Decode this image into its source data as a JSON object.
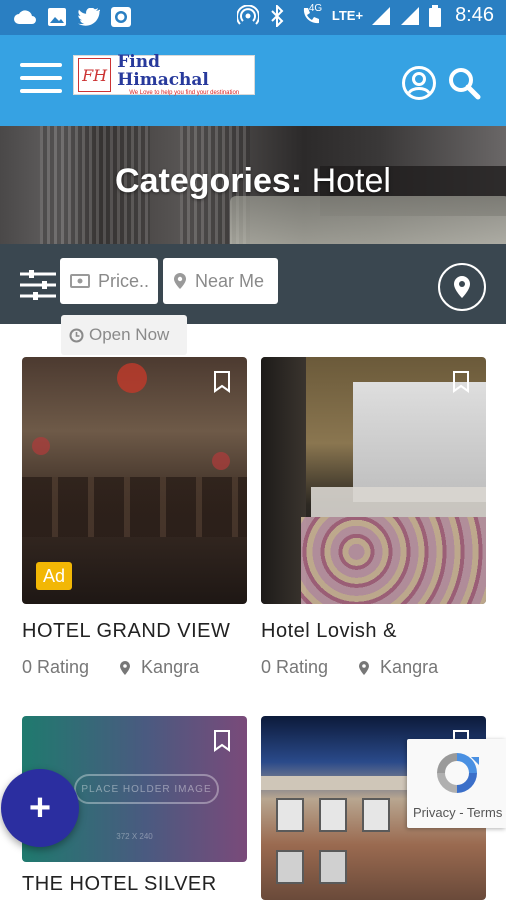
{
  "status_bar": {
    "time": "8:46",
    "network": "4G",
    "lte": "LTE+",
    "left_icons": [
      "cloud-icon",
      "image-icon",
      "twitter-icon",
      "camera-icon"
    ],
    "right_icons": [
      "hotspot-icon",
      "bluetooth-icon",
      "call-icon",
      "signal-icon",
      "signal-icon",
      "battery-icon"
    ]
  },
  "app_bar": {
    "logo_name": "Find Himachal",
    "logo_tagline": "We Love to help you find your destination",
    "logo_mark": "FH",
    "icons": [
      "menu-icon",
      "account-icon",
      "search-icon"
    ],
    "color": "#36a2e3"
  },
  "hero": {
    "title_prefix": "Categories:",
    "title_value": "Hotel"
  },
  "filters": {
    "price_placeholder": "Price..",
    "near_me_label": "Near Me",
    "open_now_label": "Open Now"
  },
  "cards": [
    {
      "title": "HOTEL GRAND VIEW",
      "rating": "0 Rating",
      "location": "Kangra",
      "badge": "Ad"
    },
    {
      "title": "Hotel Lovish &",
      "rating": "0 Rating",
      "location": "Kangra"
    },
    {
      "title": "THE HOTEL SILVER",
      "placeholder_text": "PLACE HOLDER IMAGE",
      "placeholder_size": "372 X 240"
    },
    {
      "title": ""
    }
  ],
  "recaptcha": {
    "links": "Privacy - Terms"
  },
  "fab": {
    "label": "+"
  },
  "colors": {
    "status_bar": "#2a7fc2",
    "app_bar": "#36a2e3",
    "filter_bar": "#3a4750",
    "ad_badge": "#f2b705",
    "fab": "#2b2ea0"
  }
}
